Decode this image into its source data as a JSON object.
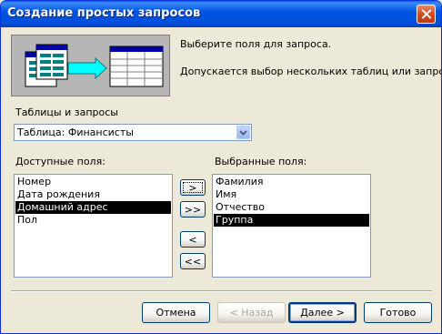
{
  "window": {
    "title": "Создание простых запросов"
  },
  "intro": {
    "line1": "Выберите поля для запроса.",
    "line2": "Допускается выбор нескольких таблиц или запросов."
  },
  "tables": {
    "label": "Таблицы и запросы",
    "selected": "Таблица: Финансисты"
  },
  "available": {
    "label": "Доступные поля:",
    "items": [
      "Номер",
      "Дата рождения",
      "Домашний адрес",
      "Пол"
    ],
    "selected_index": 2
  },
  "selected_fields": {
    "label": "Выбранные поля:",
    "items": [
      "Фамилия",
      "Имя",
      "Отчество",
      "Группа"
    ],
    "selected_index": 3
  },
  "move_buttons": {
    "add_one": ">",
    "add_all": ">>",
    "remove_one": "<",
    "remove_all": "<<"
  },
  "footer": {
    "cancel": "Отмена",
    "back": "< Назад",
    "next": "Далее >",
    "finish": "Готово"
  }
}
